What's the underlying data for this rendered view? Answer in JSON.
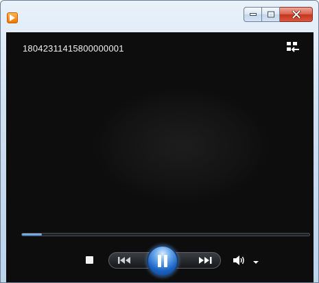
{
  "window": {
    "app_icon": "media-player-icon",
    "caption_buttons": [
      "minimize-icon",
      "maximize-icon",
      "close-icon"
    ]
  },
  "player": {
    "media_title": "18042311415800000001",
    "seek_progress": 0.07,
    "controls": {
      "stop": "stop-icon",
      "previous": "previous-track-icon",
      "play_state": "pause-icon",
      "next": "next-track-icon",
      "volume": "speaker-icon",
      "volume_menu": "chevron-down-icon",
      "switch_view": "switch-to-library-icon"
    }
  },
  "colors": {
    "video_background": "#111111",
    "accent": "#3f86d6",
    "close_button": "#c7331c"
  }
}
